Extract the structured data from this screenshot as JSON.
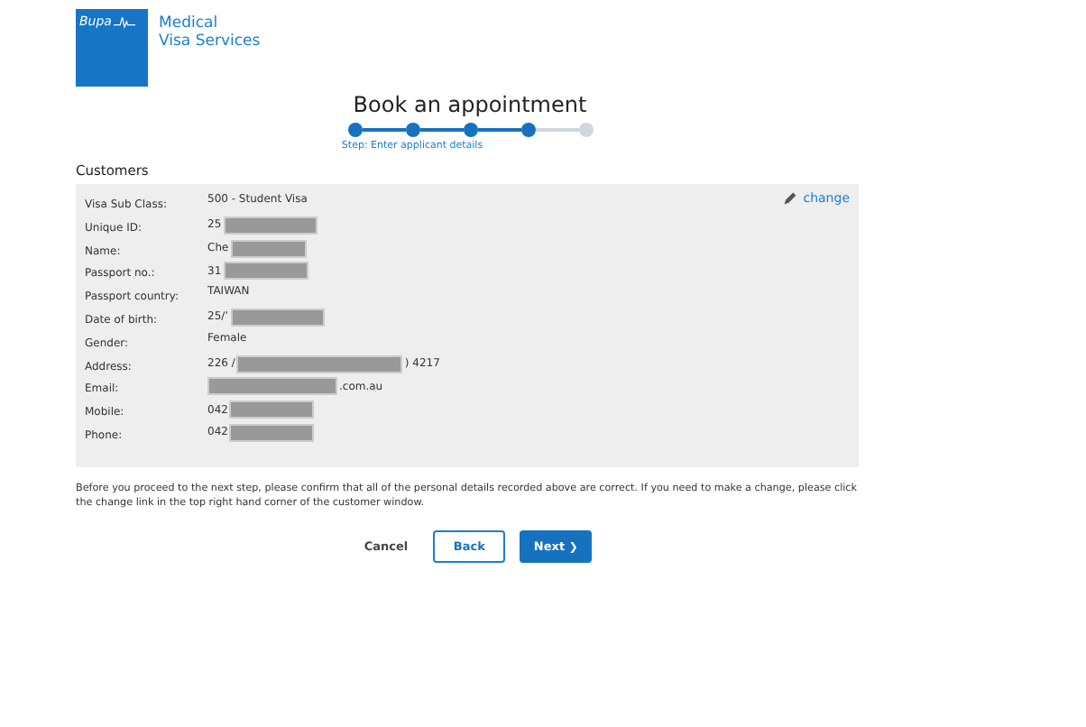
{
  "brand": {
    "logo": "Bupa",
    "name_line_1": "Medical",
    "name_line_2": "Visa Services"
  },
  "title": "Book an appointment",
  "steps": [
    {
      "done": true
    },
    {
      "done": true
    },
    {
      "done": true
    },
    {
      "done": true
    },
    {
      "done": false
    }
  ],
  "step_label": "Step: Enter applicant details",
  "section_title": "Customers",
  "change_link": "change",
  "fields": [
    {
      "label": "Visa Sub Class:",
      "value": "500 - Student Visa",
      "redacted": false
    },
    {
      "label": "Unique ID:",
      "value": "25",
      "redacted": true
    },
    {
      "label": "Name:",
      "value": "Che",
      "redacted": true
    },
    {
      "label": "Passport no.:",
      "value": "31",
      "redacted": true
    },
    {
      "label": "Passport country:",
      "value": "TAIWAN",
      "redacted": false
    },
    {
      "label": "Date of birth:",
      "value": "25/’",
      "redacted": true
    },
    {
      "label": "Gender:",
      "value": "Female",
      "redacted": false
    },
    {
      "label": "Address:",
      "value": "226 /",
      "redacted": true,
      "suffix": ") 4217"
    },
    {
      "label": "Email:",
      "redacted": true,
      "suffix": ".com.au"
    },
    {
      "label": "Mobile:",
      "value": "042",
      "redacted": true
    },
    {
      "label": "Phone:",
      "value": "042",
      "redacted": true
    }
  ],
  "notice": "Before you proceed to the next step, please confirm that all of the personal details recorded above are correct. If you need to make a change, please click the change link in the top right hand corner of the customer window.",
  "buttons": {
    "cancel": "Cancel",
    "back": "Back",
    "next": "Next",
    "next_icon": "❯"
  }
}
